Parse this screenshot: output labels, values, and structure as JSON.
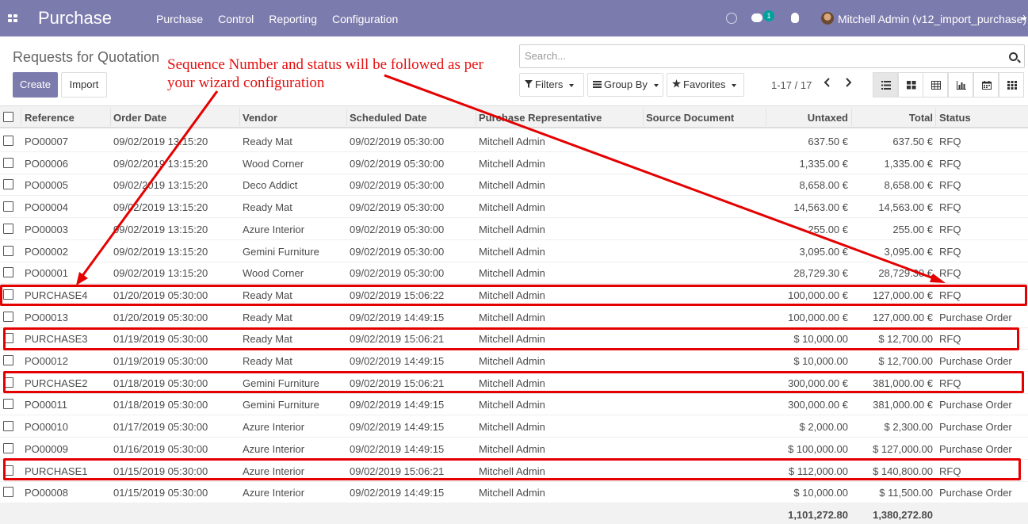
{
  "navbar": {
    "app_title": "Purchase",
    "menu": [
      "Purchase",
      "Control",
      "Reporting",
      "Configuration"
    ],
    "chat_badge": "1",
    "user": "Mitchell Admin (v12_import_purchase)"
  },
  "control_panel": {
    "breadcrumb": "Requests for Quotation",
    "create_label": "Create",
    "import_label": "Import",
    "search_placeholder": "Search...",
    "filters_label": "Filters",
    "groupby_label": "Group By",
    "favorites_label": "Favorites",
    "pager": "1-17 / 17"
  },
  "table": {
    "columns": [
      "Reference",
      "Order Date",
      "Vendor",
      "Scheduled Date",
      "Purchase Representative",
      "Source Document",
      "Untaxed",
      "Total",
      "Status"
    ],
    "rows": [
      [
        "PO00007",
        "09/02/2019 13:15:20",
        "Ready Mat",
        "09/02/2019 05:30:00",
        "Mitchell Admin",
        "",
        "637.50 €",
        "637.50 €",
        "RFQ"
      ],
      [
        "PO00006",
        "09/02/2019 13:15:20",
        "Wood Corner",
        "09/02/2019 05:30:00",
        "Mitchell Admin",
        "",
        "1,335.00 €",
        "1,335.00 €",
        "RFQ"
      ],
      [
        "PO00005",
        "09/02/2019 13:15:20",
        "Deco Addict",
        "09/02/2019 05:30:00",
        "Mitchell Admin",
        "",
        "8,658.00 €",
        "8,658.00 €",
        "RFQ"
      ],
      [
        "PO00004",
        "09/02/2019 13:15:20",
        "Ready Mat",
        "09/02/2019 05:30:00",
        "Mitchell Admin",
        "",
        "14,563.00 €",
        "14,563.00 €",
        "RFQ"
      ],
      [
        "PO00003",
        "09/02/2019 13:15:20",
        "Azure Interior",
        "09/02/2019 05:30:00",
        "Mitchell Admin",
        "",
        "255.00 €",
        "255.00 €",
        "RFQ"
      ],
      [
        "PO00002",
        "09/02/2019 13:15:20",
        "Gemini Furniture",
        "09/02/2019 05:30:00",
        "Mitchell Admin",
        "",
        "3,095.00 €",
        "3,095.00 €",
        "RFQ"
      ],
      [
        "PO00001",
        "09/02/2019 13:15:20",
        "Wood Corner",
        "09/02/2019 05:30:00",
        "Mitchell Admin",
        "",
        "28,729.30 €",
        "28,729.30 €",
        "RFQ"
      ],
      [
        "PURCHASE4",
        "01/20/2019 05:30:00",
        "Ready Mat",
        "09/02/2019 15:06:22",
        "Mitchell Admin",
        "",
        "100,000.00 €",
        "127,000.00 €",
        "RFQ"
      ],
      [
        "PO00013",
        "01/20/2019 05:30:00",
        "Ready Mat",
        "09/02/2019 14:49:15",
        "Mitchell Admin",
        "",
        "100,000.00 €",
        "127,000.00 €",
        "Purchase Order"
      ],
      [
        "PURCHASE3",
        "01/19/2019 05:30:00",
        "Ready Mat",
        "09/02/2019 15:06:21",
        "Mitchell Admin",
        "",
        "$ 10,000.00",
        "$ 12,700.00",
        "RFQ"
      ],
      [
        "PO00012",
        "01/19/2019 05:30:00",
        "Ready Mat",
        "09/02/2019 14:49:15",
        "Mitchell Admin",
        "",
        "$ 10,000.00",
        "$ 12,700.00",
        "Purchase Order"
      ],
      [
        "PURCHASE2",
        "01/18/2019 05:30:00",
        "Gemini Furniture",
        "09/02/2019 15:06:21",
        "Mitchell Admin",
        "",
        "300,000.00 €",
        "381,000.00 €",
        "RFQ"
      ],
      [
        "PO00011",
        "01/18/2019 05:30:00",
        "Gemini Furniture",
        "09/02/2019 14:49:15",
        "Mitchell Admin",
        "",
        "300,000.00 €",
        "381,000.00 €",
        "Purchase Order"
      ],
      [
        "PO00010",
        "01/17/2019 05:30:00",
        "Azure Interior",
        "09/02/2019 14:49:15",
        "Mitchell Admin",
        "",
        "$ 2,000.00",
        "$ 2,300.00",
        "Purchase Order"
      ],
      [
        "PO00009",
        "01/16/2019 05:30:00",
        "Azure Interior",
        "09/02/2019 14:49:15",
        "Mitchell Admin",
        "",
        "$ 100,000.00",
        "$ 127,000.00",
        "Purchase Order"
      ],
      [
        "PURCHASE1",
        "01/15/2019 05:30:00",
        "Azure Interior",
        "09/02/2019 15:06:21",
        "Mitchell Admin",
        "",
        "$ 112,000.00",
        "$ 140,800.00",
        "RFQ"
      ],
      [
        "PO00008",
        "01/15/2019 05:30:00",
        "Azure Interior",
        "09/02/2019 14:49:15",
        "Mitchell Admin",
        "",
        "$ 10,000.00",
        "$ 11,500.00",
        "Purchase Order"
      ]
    ],
    "footer_untaxed": "1,101,272.80",
    "footer_total": "1,380,272.80"
  },
  "annotation": {
    "text_line1": "Sequence Number and status will be followed as per",
    "text_line2": "your wizard configuration",
    "color": "#e51010"
  },
  "colors": {
    "navbar": "#7c7bad",
    "primary_button": "#7c7bad",
    "badge": "#00a09d"
  }
}
